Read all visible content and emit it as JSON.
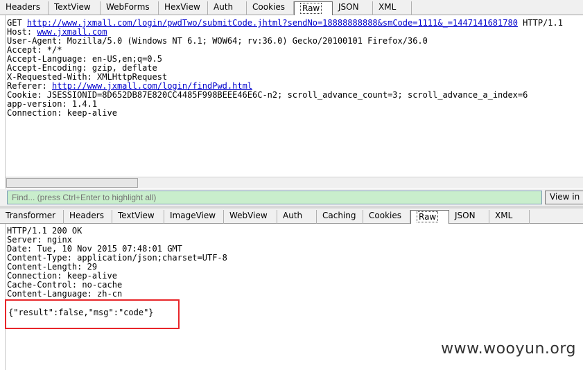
{
  "request": {
    "tabs": [
      "Headers",
      "TextView",
      "WebForms",
      "HexView",
      "Auth",
      "Cookies",
      "Raw",
      "JSON",
      "XML"
    ],
    "active_tab": "Raw",
    "raw": {
      "method": "GET",
      "url": "http://www.jxmall.com/login/pwdTwo/submitCode.jhtml?sendNo=18888888888&smCode=1111&_=1447141681780",
      "url_suffix": " HTTP/1.1",
      "host_label": "Host:",
      "host": "www.jxmall.com",
      "user_agent": "User-Agent: Mozilla/5.0 (Windows NT 6.1; WOW64; rv:36.0) Gecko/20100101 Firefox/36.0",
      "accept": "Accept: */*",
      "accept_language": "Accept-Language: en-US,en;q=0.5",
      "accept_encoding": "Accept-Encoding: gzip, deflate",
      "x_requested_with": "X-Requested-With: XMLHttpRequest",
      "referer_label": "Referer:",
      "referer": "http://www.jxmall.com/login/findPwd.html",
      "cookie": "Cookie: JSESSIONID=8D652DB87E820CC4485F998BEEE46E6C-n2; scroll_advance_count=3; scroll_advance_a_index=6",
      "app_version": "app-version: 1.4.1",
      "connection": "Connection: keep-alive"
    }
  },
  "find": {
    "placeholder": "Find... (press Ctrl+Enter to highlight all)",
    "button_label": "View in Notepad"
  },
  "response": {
    "tabs": [
      "Transformer",
      "Headers",
      "TextView",
      "ImageView",
      "WebView",
      "Auth",
      "Caching",
      "Cookies",
      "Raw",
      "JSON",
      "XML"
    ],
    "active_tab": "Raw",
    "lines": [
      "HTTP/1.1 200 OK",
      "Server: nginx",
      "Date: Tue, 10 Nov 2015 07:48:01 GMT",
      "Content-Type: application/json;charset=UTF-8",
      "Content-Length: 29",
      "Connection: keep-alive",
      "Cache-Control: no-cache",
      "Content-Language: zh-cn"
    ],
    "body": "{\"result\":false,\"msg\":\"code\"}"
  },
  "watermark": "www.wooyun.org",
  "colors": {
    "find_bg": "#c9eecc",
    "highlight_border": "#e8262a",
    "link": "#0000cc"
  }
}
